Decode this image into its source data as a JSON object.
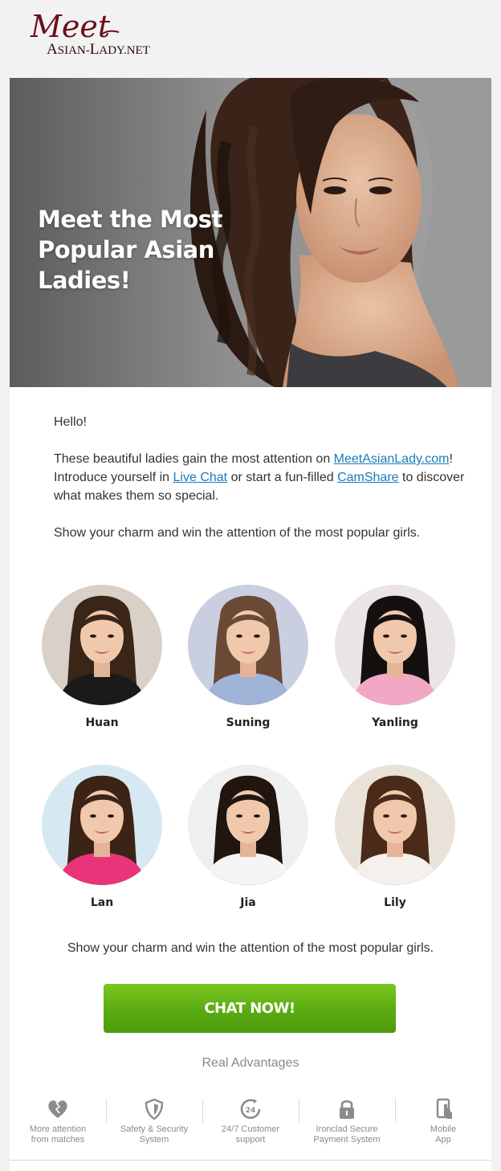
{
  "logo": {
    "script": "Meet",
    "sub": "Asian-Lady.net"
  },
  "hero": {
    "title": "Meet the Most Popular Asian Ladies!"
  },
  "intro": {
    "greeting": "Hello!",
    "p1_before": "These beautiful ladies gain the most attention on ",
    "p1_link1": "MeetAsianLady.com",
    "p1_after_link1": "! Introduce yourself in ",
    "p1_link2": "Live Chat",
    "p1_mid": " or start a fun-filled ",
    "p1_link3": "CamShare",
    "p1_end": " to discover what makes them so special.",
    "p2": "Show your charm and win the attention of the most popular girls."
  },
  "profiles": [
    {
      "name": "Huan",
      "bg": "#d9d0c8",
      "hair": "#3a2618",
      "top": "#1a1a1a"
    },
    {
      "name": "Suning",
      "bg": "#c9cfe0",
      "hair": "#6b4a35",
      "top": "#9fb3d6"
    },
    {
      "name": "Yanling",
      "bg": "#ebe4e4",
      "hair": "#151010",
      "top": "#f2a8c4"
    },
    {
      "name": "Lan",
      "bg": "#d6e8f2",
      "hair": "#3b2415",
      "top": "#e8357a"
    },
    {
      "name": "Jia",
      "bg": "#efefef",
      "hair": "#20150f",
      "top": "#f5f5f5"
    },
    {
      "name": "Lily",
      "bg": "#e8e2d8",
      "hair": "#4a2a18",
      "top": "#f4f1ec"
    }
  ],
  "tagline": "Show your charm and win the attention of the most popular girls.",
  "cta": {
    "label": "CHAT NOW!"
  },
  "advantages": {
    "title": "Real  Advantages",
    "items": [
      {
        "icon": "heart-icon",
        "label": "More attention\nfrom matches"
      },
      {
        "icon": "shield-icon",
        "label": "Safety & Security\nSystem"
      },
      {
        "icon": "clock-24-icon",
        "label": "24/7 Customer\nsupport"
      },
      {
        "icon": "lock-icon",
        "label": "Ironclad Secure\nPayment System"
      },
      {
        "icon": "mobile-icon",
        "label": "Mobile\nApp"
      }
    ]
  },
  "colors": {
    "brand": "#6b0f1a",
    "link": "#1a7bbf",
    "cta": "#5aab12"
  }
}
